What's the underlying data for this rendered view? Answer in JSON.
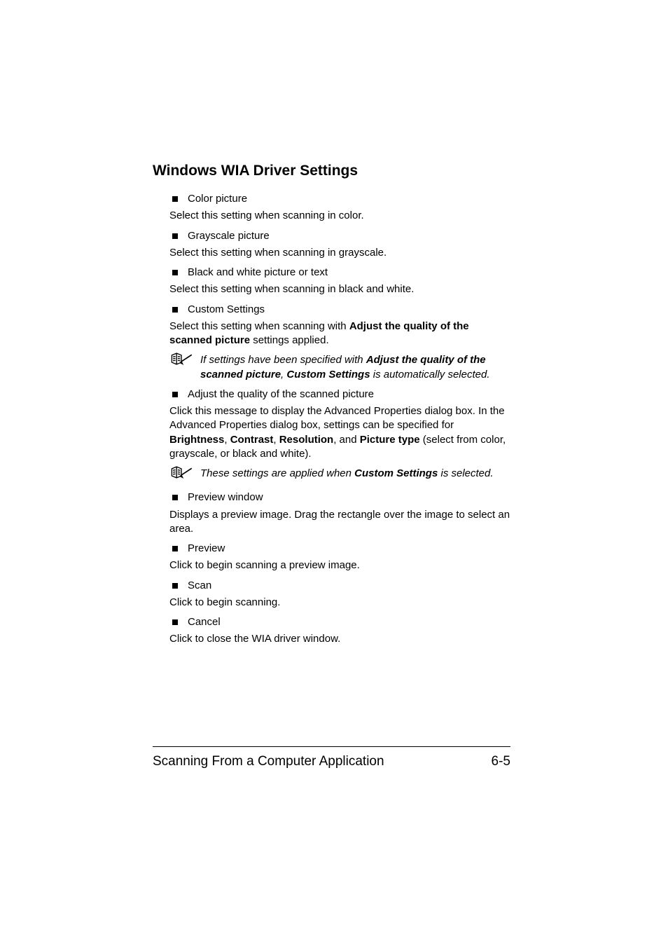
{
  "heading": "Windows WIA Driver Settings",
  "items": {
    "color": {
      "label": "Color picture",
      "desc": "Select this setting when scanning in color."
    },
    "grayscale": {
      "label": "Grayscale picture",
      "desc": "Select this setting when scanning in grayscale."
    },
    "bw": {
      "label": "Black and white picture or text",
      "desc": "Select this setting when scanning in black and white."
    },
    "custom": {
      "label": "Custom Settings",
      "desc_pre": "Select this setting when scanning with ",
      "desc_bold": "Adjust the quality of the scanned picture",
      "desc_post": " settings applied."
    },
    "adjust": {
      "label": "Adjust the quality of the scanned picture",
      "desc_p1_pre": "Click this message to display the Advanced Properties dialog box. In the Advanced Properties dialog box, settings can be specified for ",
      "brightness": "Brightness",
      "sep1": ", ",
      "contrast": "Contrast",
      "sep2": ", ",
      "resolution": "Resolution",
      "sep3": ", and ",
      "ptype": "Picture type",
      "desc_p1_post": " (select from color, grayscale, or black and white)."
    },
    "preview_win": {
      "label": "Preview window",
      "desc": "Displays a preview image. Drag the rectangle over the image to select an area."
    },
    "preview": {
      "label": "Preview",
      "desc": "Click to begin scanning a preview image."
    },
    "scan": {
      "label": "Scan",
      "desc": "Click to begin scanning."
    },
    "cancel": {
      "label": "Cancel",
      "desc": "Click to close the WIA driver window."
    }
  },
  "note1": {
    "pre": "If settings have been specified with ",
    "b1": "Adjust the quality of the scanned picture",
    "mid": ", ",
    "b2": "Custom Settings",
    "post": " is automatically selected."
  },
  "note2": {
    "pre": "These settings are applied when ",
    "b1": "Custom Settings",
    "post": " is selected."
  },
  "footer": {
    "left": "Scanning From a Computer Application",
    "right": "6-5"
  }
}
